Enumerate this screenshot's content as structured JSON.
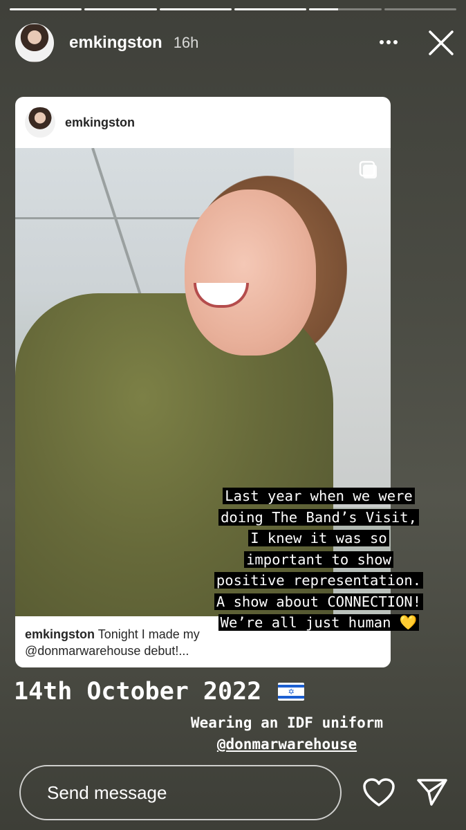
{
  "story": {
    "progress_segments": [
      1,
      1,
      1,
      1,
      0.4,
      0
    ],
    "username": "emkingston",
    "time_ago": "16h",
    "more_icon": "more-horizontal-icon",
    "close_icon": "close-icon"
  },
  "shared_post": {
    "username": "emkingston",
    "caption_username": "emkingston",
    "caption_text": " Tonight I made my",
    "caption_line2": "@donmarwarehouse debut!..."
  },
  "overlay_lines": [
    "Last year when we were",
    "doing The Band’s Visit,",
    "I knew it was so",
    "important to show",
    "positive representation.",
    "A show about CONNECTION!",
    "We’re all just human 💛"
  ],
  "date_text": "14th October 2022",
  "sub_caption": {
    "line1": "Wearing an IDF uniform",
    "mention": "@donmarwarehouse"
  },
  "reply": {
    "placeholder": "Send message"
  },
  "colors": {
    "flag_blue": "#1c5fd1",
    "background": "#4a4b43"
  }
}
